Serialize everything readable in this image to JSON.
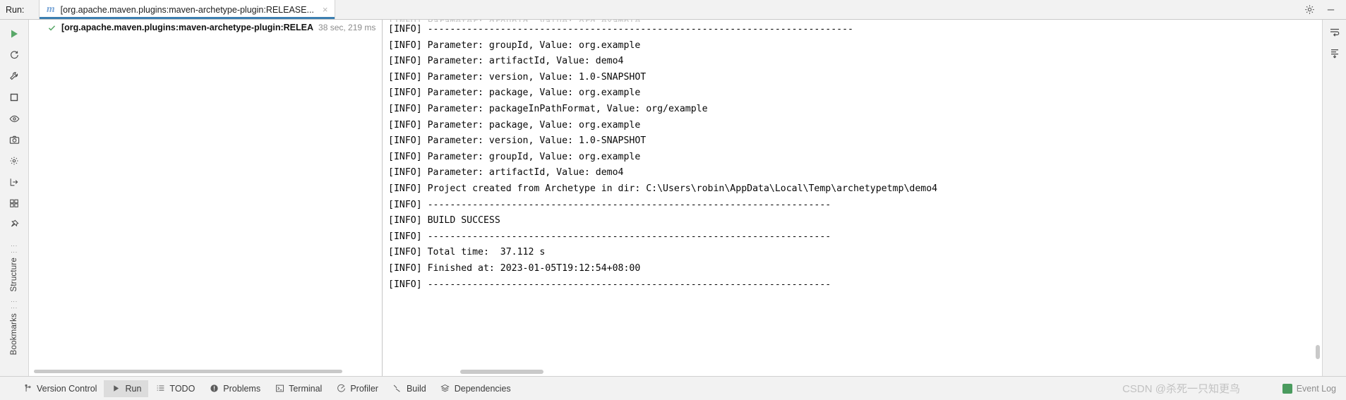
{
  "window": {
    "run_label": "Run:",
    "tab_title": "[org.apache.maven.plugins:maven-archetype-plugin:RELEASE...",
    "tab_close": "×",
    "settings_icon": "gear-icon",
    "minimize_icon": "minimize-icon"
  },
  "tree": {
    "status_icon": "check-icon",
    "title": "[org.apache.maven.plugins:maven-archetype-plugin:RELEA",
    "duration": "38 sec, 219 ms"
  },
  "left_toolbar": {
    "buttons": [
      {
        "name": "rerun-button",
        "glyph": "▶"
      },
      {
        "name": "rerun-failed-tests-button",
        "glyph": "↻"
      },
      {
        "name": "configure-button",
        "glyph": "🔧"
      },
      {
        "name": "stop-button",
        "glyph": "■"
      },
      {
        "name": "toggle-visibility-button",
        "glyph": "◉"
      },
      {
        "name": "export-screenshot-button",
        "glyph": "📷"
      },
      {
        "name": "filter-button",
        "glyph": "⚙"
      },
      {
        "name": "import-button",
        "glyph": "⮏"
      },
      {
        "name": "expand-all-button",
        "glyph": "▦"
      },
      {
        "name": "pin-tab-button",
        "glyph": "📌"
      }
    ],
    "vertical_labels": [
      "Structure",
      "Bookmarks"
    ]
  },
  "right_toolbar": {
    "buttons": [
      {
        "name": "soft-wrap-button",
        "glyph": "≡"
      },
      {
        "name": "scroll-to-end-button",
        "glyph": "↓"
      }
    ]
  },
  "console": {
    "clipped_line": "[INFO] Parameter: groupId, Value: org.example",
    "lines": [
      "[INFO] ----------------------------------------------------------------------------",
      "[INFO] Parameter: groupId, Value: org.example",
      "[INFO] Parameter: artifactId, Value: demo4",
      "[INFO] Parameter: version, Value: 1.0-SNAPSHOT",
      "[INFO] Parameter: package, Value: org.example",
      "[INFO] Parameter: packageInPathFormat, Value: org/example",
      "[INFO] Parameter: package, Value: org.example",
      "[INFO] Parameter: version, Value: 1.0-SNAPSHOT",
      "[INFO] Parameter: groupId, Value: org.example",
      "[INFO] Parameter: artifactId, Value: demo4",
      "[INFO] Project created from Archetype in dir: C:\\Users\\robin\\AppData\\Local\\Temp\\archetypetmp\\demo4",
      "[INFO] ------------------------------------------------------------------------",
      "[INFO] BUILD SUCCESS",
      "[INFO] ------------------------------------------------------------------------",
      "[INFO] Total time:  37.112 s",
      "[INFO] Finished at: 2023-01-05T19:12:54+08:00",
      "[INFO] ------------------------------------------------------------------------"
    ]
  },
  "statusbar": {
    "items": [
      {
        "name": "version-control",
        "label": "Version Control",
        "icon": "branch-icon",
        "active": false
      },
      {
        "name": "run",
        "label": "Run",
        "icon": "play-icon",
        "active": true
      },
      {
        "name": "todo",
        "label": "TODO",
        "icon": "list-icon",
        "active": false
      },
      {
        "name": "problems",
        "label": "Problems",
        "icon": "error-icon",
        "active": false
      },
      {
        "name": "terminal",
        "label": "Terminal",
        "icon": "terminal-icon",
        "active": false
      },
      {
        "name": "profiler",
        "label": "Profiler",
        "icon": "profiler-icon",
        "active": false
      },
      {
        "name": "build",
        "label": "Build",
        "icon": "hammer-icon",
        "active": false
      },
      {
        "name": "dependencies",
        "label": "Dependencies",
        "icon": "layers-icon",
        "active": false
      }
    ],
    "event_log": "Event Log",
    "watermark": "CSDN @杀死一只知更鸟"
  },
  "colors": {
    "accent": "#3c7fb1",
    "success": "#59a869",
    "panel": "#f2f2f2",
    "console_text": "#080808",
    "muted": "#8c8c8c"
  }
}
